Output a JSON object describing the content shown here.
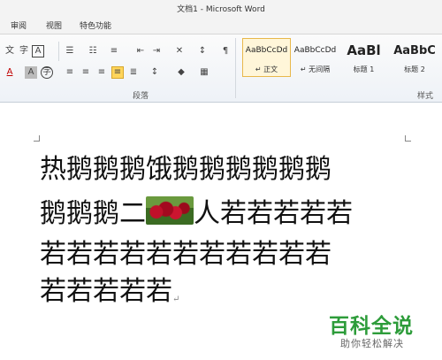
{
  "window": {
    "title": "文档1 - Microsoft Word"
  },
  "tabs": [
    "审阅",
    "视图",
    "特色功能"
  ],
  "ribbon": {
    "paragraph_group_label": "段落",
    "styles_group_label": "样式",
    "row1_icons": [
      "pinyin-icon",
      "enclose-char-icon",
      "char-border-icon",
      "bullets-icon",
      "numbering-icon",
      "multilevel-list-icon",
      "decrease-indent-icon",
      "increase-indent-icon",
      "chinese-layout-icon",
      "sort-icon",
      "show-marks-icon"
    ],
    "row2_icons": [
      "font-color-icon",
      "char-shading-icon",
      "enclose-char-icon",
      "align-left-icon",
      "center-icon",
      "align-right-icon",
      "justify-icon",
      "distributed-icon",
      "line-spacing-icon",
      "shading-icon",
      "borders-icon"
    ],
    "styles": [
      {
        "sample": "AaBbCcDd",
        "name": "↵ 正文",
        "selected": true
      },
      {
        "sample": "AaBbCcDd",
        "name": "↵ 无间隔",
        "selected": false
      },
      {
        "sample": "AaBl",
        "name": "标题 1",
        "selected": false
      },
      {
        "sample": "AaBbC",
        "name": "标题 2",
        "selected": false
      }
    ]
  },
  "document": {
    "lines": [
      "热鹅鹅鹅饿鹅鹅鹅鹅鹅鹅",
      "鹅鹅鹅二",
      "人若若若若若",
      "若若若若若若若若若若若",
      "若若若若若"
    ],
    "paragraph_mark": "↵",
    "image": "cherries-image"
  },
  "watermark": {
    "title": "百科全说",
    "subtitle": "助你轻松解决"
  }
}
